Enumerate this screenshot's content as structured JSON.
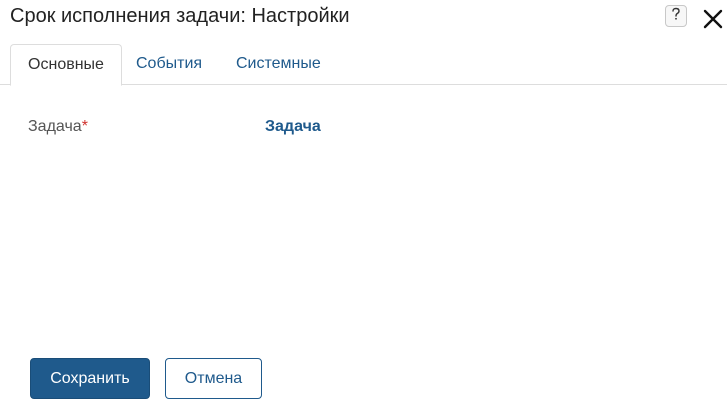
{
  "dialog": {
    "title": "Срок исполнения задачи: Настройки",
    "help_icon": "question-icon",
    "close_icon": "close-icon"
  },
  "tabs": [
    {
      "label": "Основные",
      "active": true
    },
    {
      "label": "События",
      "active": false
    },
    {
      "label": "Системные",
      "active": false
    }
  ],
  "form": {
    "field_label": "Задача",
    "required_mark": "*",
    "field_value": "Задача"
  },
  "buttons": {
    "save_label": "Сохранить",
    "cancel_label": "Отмена"
  },
  "colors": {
    "accent": "#1f5a8c",
    "required": "#d0312d",
    "border": "#dddddd"
  }
}
